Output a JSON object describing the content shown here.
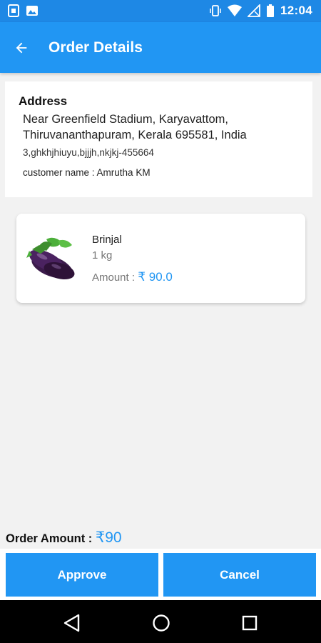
{
  "status_bar": {
    "time": "12:04",
    "icons": [
      "screenshot-app-icon",
      "gallery-icon",
      "vibrate-icon",
      "wifi-icon",
      "no-signal-icon",
      "battery-icon"
    ]
  },
  "app_bar": {
    "title": "Order Details",
    "back_icon": "arrow-left-icon"
  },
  "address": {
    "heading": "Address",
    "line1": "Near Greenfield Stadium, Karyavattom,",
    "line2": "Thiruvananthapuram, Kerala 695581, India",
    "line3": "3,ghkhjhiuyu,bjjjh,nkjkj-455664",
    "customer_label": "customer name : ",
    "customer_name": "Amrutha KM"
  },
  "item": {
    "image_icon": "brinjal-image",
    "name": "Brinjal",
    "quantity": "1 kg",
    "amount_label": "Amount : ",
    "amount_value": "₹ 90.0"
  },
  "order": {
    "label": "Order Amount : ",
    "value": "₹90"
  },
  "buttons": {
    "approve": "Approve",
    "cancel": "Cancel"
  },
  "nav": {
    "icons": [
      "nav-back-icon",
      "nav-home-icon",
      "nav-recent-icon"
    ]
  },
  "colors": {
    "primary": "#2196f3",
    "status_bar": "#1e88e5",
    "background": "#f2f2f2"
  }
}
